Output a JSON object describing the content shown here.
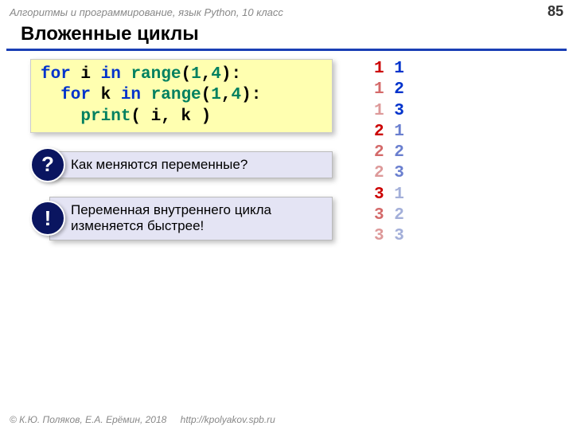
{
  "header": {
    "course": "Алгоритмы и программирование, язык Python, 10 класс",
    "page": "85"
  },
  "title": "Вложенные циклы",
  "code": {
    "l1a": "for",
    "l1b": " i ",
    "l1c": "in",
    "l1d": " range",
    "l1e": "(",
    "l1f": "1",
    "l1g": ",",
    "l1h": "4",
    "l1i": "):",
    "l2a": "  for",
    "l2b": " k ",
    "l2c": "in",
    "l2d": " range",
    "l2e": "(",
    "l2f": "1",
    "l2g": ",",
    "l2h": "4",
    "l2i": "):",
    "l3a": "    print",
    "l3b": "( i, k )"
  },
  "callouts": {
    "q_badge": "?",
    "q_text": "Как меняются переменные?",
    "e_badge": "!",
    "e_text": "Переменная внутреннего цикла изменяется быстрее!"
  },
  "output": [
    {
      "i": "1",
      "k": "1",
      "ic": "i0",
      "kc": "k0"
    },
    {
      "i": "1",
      "k": "2",
      "ic": "i1",
      "kc": "k0"
    },
    {
      "i": "1",
      "k": "3",
      "ic": "i2",
      "kc": "k0"
    },
    {
      "i": "2",
      "k": "1",
      "ic": "i0",
      "kc": "k1"
    },
    {
      "i": "2",
      "k": "2",
      "ic": "i1",
      "kc": "k1"
    },
    {
      "i": "2",
      "k": "3",
      "ic": "i2",
      "kc": "k1"
    },
    {
      "i": "3",
      "k": "1",
      "ic": "i0",
      "kc": "k2"
    },
    {
      "i": "3",
      "k": "2",
      "ic": "i1",
      "kc": "k2"
    },
    {
      "i": "3",
      "k": "3",
      "ic": "i2",
      "kc": "k2"
    }
  ],
  "footer": {
    "copyright": "© К.Ю. Поляков, Е.А. Ерёмин, 2018",
    "url": "http://kpolyakov.spb.ru"
  }
}
